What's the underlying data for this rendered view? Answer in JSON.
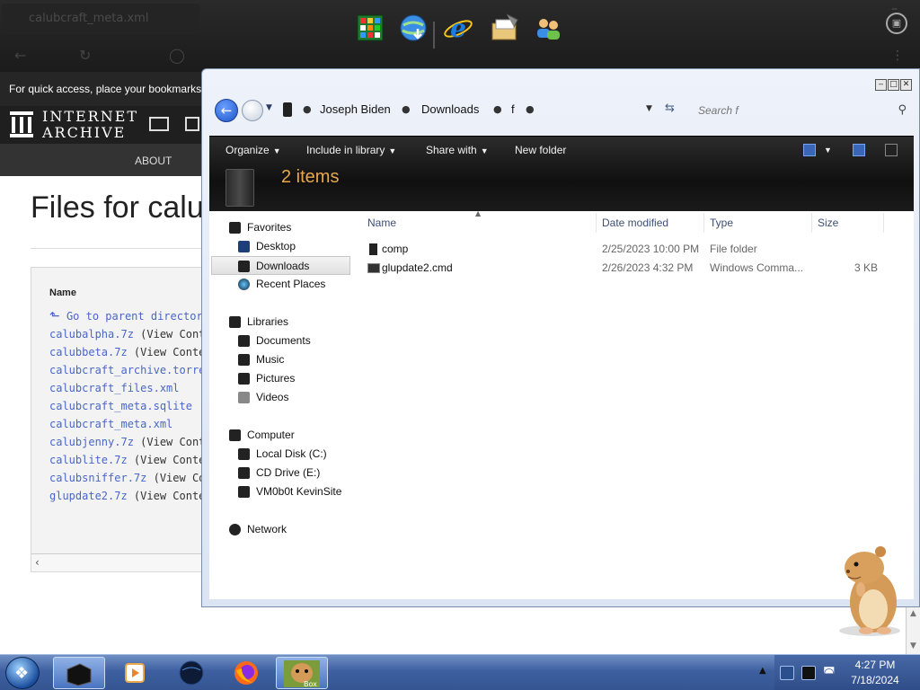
{
  "browser": {
    "tab_title": "calubcraft_meta.xml",
    "bookmarks_hint": "For quick access, place your bookmarks here on the bookmarks bar.",
    "site_name_line1": "INTERNET",
    "site_name_line2": "ARCHIVE",
    "nav_about": "ABOUT",
    "page_title": "Files for calubcraft",
    "column_name": "Name",
    "files": [
      {
        "name": "Go to parent directory",
        "suffix": ""
      },
      {
        "name": "calubalpha.7z",
        "suffix": " (View Contents)"
      },
      {
        "name": "calubbeta.7z",
        "suffix": " (View Contents)"
      },
      {
        "name": "calubcraft_archive.torrent",
        "suffix": ""
      },
      {
        "name": "calubcraft_files.xml",
        "suffix": ""
      },
      {
        "name": "calubcraft_meta.sqlite",
        "suffix": ""
      },
      {
        "name": "calubcraft_meta.xml",
        "suffix": ""
      },
      {
        "name": "calubjenny.7z",
        "suffix": " (View Contents)"
      },
      {
        "name": "calublite.7z",
        "suffix": " (View Contents)"
      },
      {
        "name": "calubsniffer.7z",
        "suffix": " (View Contents)"
      },
      {
        "name": "glupdate2.7z",
        "suffix": " (View Contents)"
      }
    ]
  },
  "explorer": {
    "window_buttons": {
      "minimize": "‒",
      "maximize": "□",
      "close": "✕"
    },
    "breadcrumb": [
      "Joseph Biden",
      "Downloads",
      "f"
    ],
    "search_placeholder": "Search f",
    "toolbar": {
      "organize": "Organize",
      "include_in_library": "Include in library",
      "share_with": "Share with",
      "new_folder": "New folder"
    },
    "item_count": "2 items",
    "nav": {
      "favorites": "Favorites",
      "desktop": "Desktop",
      "downloads": "Downloads",
      "recent_places": "Recent Places",
      "libraries": "Libraries",
      "documents": "Documents",
      "music": "Music",
      "pictures": "Pictures",
      "videos": "Videos",
      "computer": "Computer",
      "local_disk": "Local Disk (C:)",
      "cd_drive": "CD Drive (E:)",
      "vm_site": "VM0b0t KevinSite",
      "network": "Network"
    },
    "columns": {
      "name": "Name",
      "date_modified": "Date modified",
      "type": "Type",
      "size": "Size"
    },
    "files": [
      {
        "name": "comp",
        "date": "2/25/2023 10:00 PM",
        "type": "File folder",
        "size": ""
      },
      {
        "name": "glupdate2.cmd",
        "date": "2/26/2023 4:32 PM",
        "type": "Windows Comma...",
        "size": "3 KB"
      }
    ]
  },
  "taskbar": {
    "time": "4:27 PM",
    "date": "7/18/2024",
    "box_label": "Box"
  },
  "colors": {
    "accent_orange": "#e8a84b",
    "link_blue": "#4a66c9",
    "taskbar_blue": "#3e60a0"
  }
}
